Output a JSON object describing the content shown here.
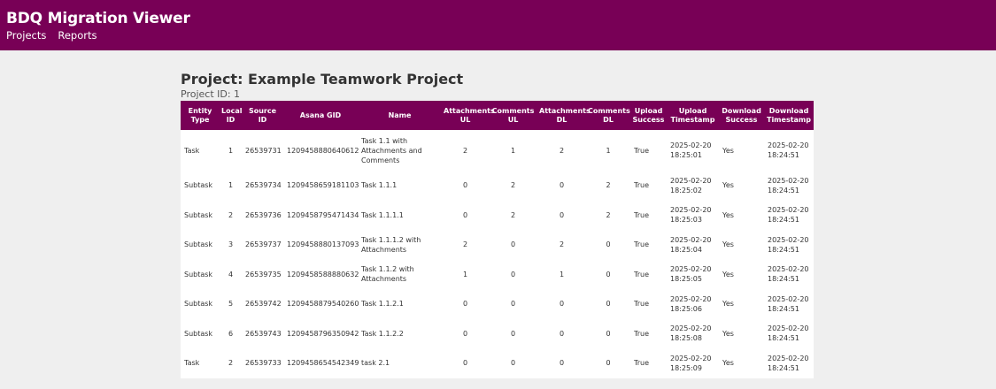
{
  "app": {
    "title": "BDQ Migration Viewer"
  },
  "nav": {
    "items": [
      "Projects",
      "Reports"
    ]
  },
  "page": {
    "title": "Project: Example Teamwork Project",
    "project_id": "Project ID: 1"
  },
  "table": {
    "headers": [
      "Entity Type",
      "Local ID",
      "Source ID",
      "Asana GID",
      "Name",
      "Attachments UL",
      "Comments UL",
      "Attachments DL",
      "Comments DL",
      "Upload Success",
      "Upload Timestamp",
      "Download Success",
      "Download Timestamp"
    ],
    "rows": [
      [
        "Task",
        "1",
        "26539731",
        "1209458880640612",
        "Task 1.1 with Attachments and Comments",
        "2",
        "1",
        "2",
        "1",
        "True",
        "2025-02-20 18:25:01",
        "Yes",
        "2025-02-20 18:24:51"
      ],
      [
        "Subtask",
        "1",
        "26539734",
        "1209458659181103",
        "Task 1.1.1",
        "0",
        "2",
        "0",
        "2",
        "True",
        "2025-02-20 18:25:02",
        "Yes",
        "2025-02-20 18:24:51"
      ],
      [
        "Subtask",
        "2",
        "26539736",
        "1209458795471434",
        "Task 1.1.1.1",
        "0",
        "2",
        "0",
        "2",
        "True",
        "2025-02-20 18:25:03",
        "Yes",
        "2025-02-20 18:24:51"
      ],
      [
        "Subtask",
        "3",
        "26539737",
        "1209458880137093",
        "Task 1.1.1.2 with Attachments",
        "2",
        "0",
        "2",
        "0",
        "True",
        "2025-02-20 18:25:04",
        "Yes",
        "2025-02-20 18:24:51"
      ],
      [
        "Subtask",
        "4",
        "26539735",
        "1209458588880632",
        "Task 1.1.2 with Attachments",
        "1",
        "0",
        "1",
        "0",
        "True",
        "2025-02-20 18:25:05",
        "Yes",
        "2025-02-20 18:24:51"
      ],
      [
        "Subtask",
        "5",
        "26539742",
        "1209458879540260",
        "Task 1.1.2.1",
        "0",
        "0",
        "0",
        "0",
        "True",
        "2025-02-20 18:25:06",
        "Yes",
        "2025-02-20 18:24:51"
      ],
      [
        "Subtask",
        "6",
        "26539743",
        "1209458796350942",
        "Task 1.1.2.2",
        "0",
        "0",
        "0",
        "0",
        "True",
        "2025-02-20 18:25:08",
        "Yes",
        "2025-02-20 18:24:51"
      ],
      [
        "Task",
        "2",
        "26539733",
        "1209458654542349",
        "task 2.1",
        "0",
        "0",
        "0",
        "0",
        "True",
        "2025-02-20 18:25:09",
        "Yes",
        "2025-02-20 18:24:51"
      ]
    ]
  }
}
